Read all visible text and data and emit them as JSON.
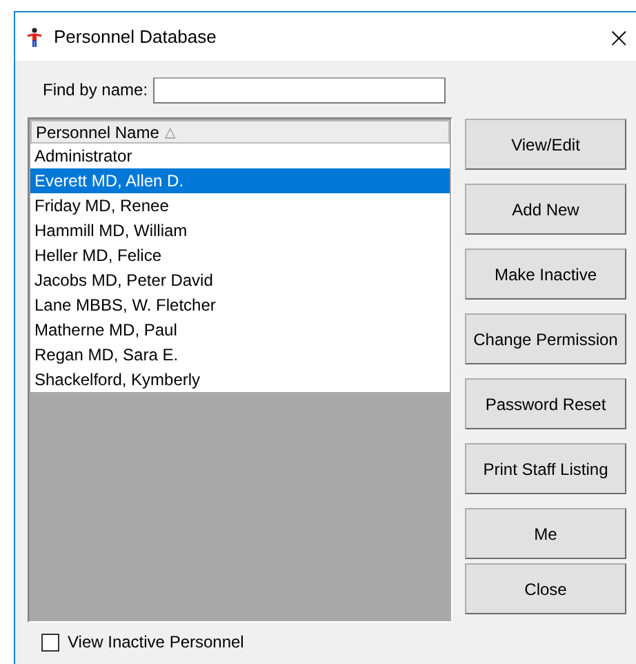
{
  "window": {
    "title": "Personnel Database",
    "close": "×"
  },
  "search": {
    "label": "Find by name:"
  },
  "list": {
    "column": "Personnel Name",
    "sort_indicator": "△",
    "rows": [
      {
        "name": "Administrator",
        "selected": false
      },
      {
        "name": "Everett MD, Allen D.",
        "selected": true
      },
      {
        "name": "Friday MD, Renee",
        "selected": false
      },
      {
        "name": "Hammill MD, William",
        "selected": false
      },
      {
        "name": "Heller MD, Felice",
        "selected": false
      },
      {
        "name": "Jacobs MD, Peter David",
        "selected": false
      },
      {
        "name": "Lane MBBS, W. Fletcher",
        "selected": false
      },
      {
        "name": "Matherne MD, Paul",
        "selected": false
      },
      {
        "name": "Regan MD, Sara E.",
        "selected": false
      },
      {
        "name": "Shackelford, Kymberly",
        "selected": false
      }
    ]
  },
  "buttons": [
    "View/Edit",
    "Add New",
    "Make Inactive",
    "Change Permission",
    "Password Reset",
    "Print Staff Listing",
    "Me",
    "Close"
  ],
  "view_inactive": {
    "label": "View Inactive Personnel",
    "checked": false
  }
}
